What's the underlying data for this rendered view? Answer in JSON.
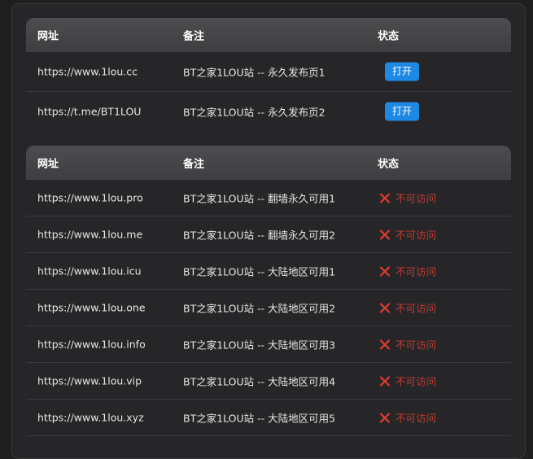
{
  "table1": {
    "headers": [
      "网址",
      "备注",
      "状态"
    ],
    "rows": [
      {
        "url": "https://www.1lou.cc",
        "note": "BT之家1LOU站 -- 永久发布页1",
        "status": "打开"
      },
      {
        "url": "https://t.me/BT1LOU",
        "note": "BT之家1LOU站 -- 永久发布页2",
        "status": "打开"
      }
    ]
  },
  "table2": {
    "headers": [
      "网址",
      "备注",
      "状态"
    ],
    "rows": [
      {
        "url": "https://www.1lou.pro",
        "note": "BT之家1LOU站 -- 翻墙永久可用1",
        "status": "不可访问"
      },
      {
        "url": "https://www.1lou.me",
        "note": "BT之家1LOU站 -- 翻墙永久可用2",
        "status": "不可访问"
      },
      {
        "url": "https://www.1lou.icu",
        "note": "BT之家1LOU站 -- 大陆地区可用1",
        "status": "不可访问"
      },
      {
        "url": "https://www.1lou.one",
        "note": "BT之家1LOU站 -- 大陆地区可用2",
        "status": "不可访问"
      },
      {
        "url": "https://www.1lou.info",
        "note": "BT之家1LOU站 -- 大陆地区可用3",
        "status": "不可访问"
      },
      {
        "url": "https://www.1lou.vip",
        "note": "BT之家1LOU站 -- 大陆地区可用4",
        "status": "不可访问"
      },
      {
        "url": "https://www.1lou.xyz",
        "note": "BT之家1LOU站 -- 大陆地区可用5",
        "status": "不可访问"
      }
    ]
  },
  "colors": {
    "open_button": "#1e88e5",
    "unavailable": "#c33b32"
  },
  "icons": {
    "unavailable": "x-icon"
  }
}
